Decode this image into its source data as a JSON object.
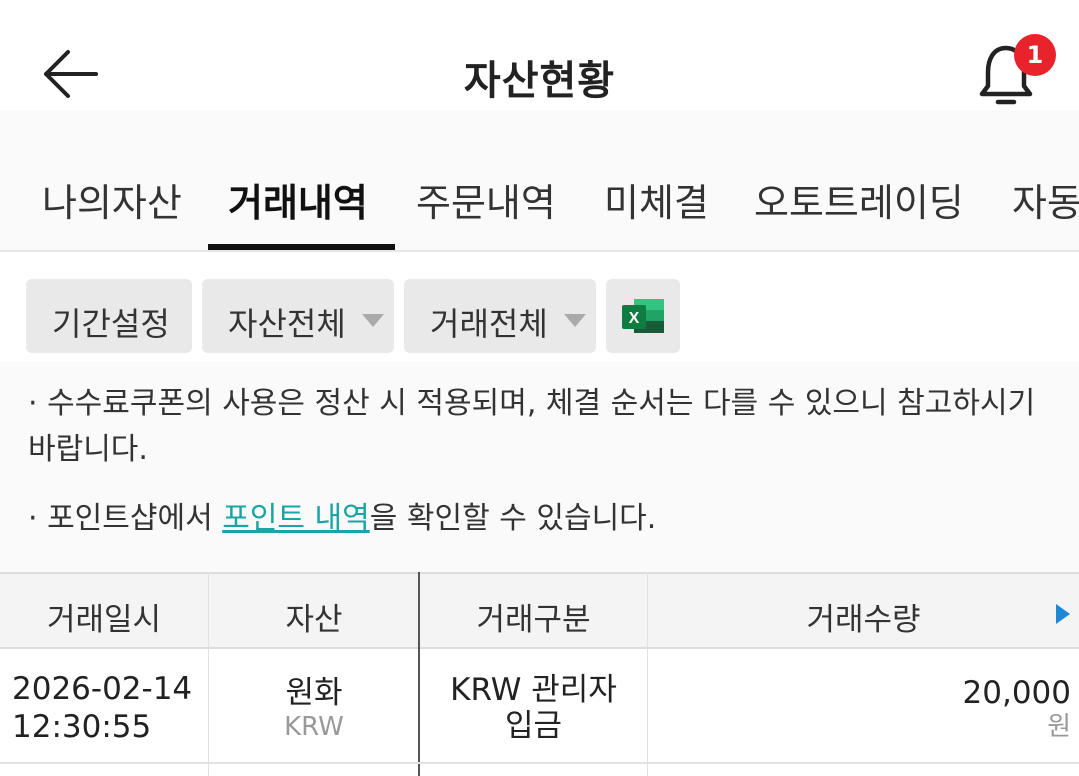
{
  "header": {
    "title": "자산현황",
    "notification_count": "1"
  },
  "tabs": [
    {
      "label": "나의자산",
      "active": false
    },
    {
      "label": "거래내역",
      "active": true
    },
    {
      "label": "주문내역",
      "active": false
    },
    {
      "label": "미체결",
      "active": false
    },
    {
      "label": "오토트레이딩",
      "active": false
    },
    {
      "label": "자동",
      "active": false
    }
  ],
  "filters": {
    "period": "기간설정",
    "asset": "자산전체",
    "trade": "거래전체"
  },
  "notices": {
    "line1": "· 수수료쿠폰의 사용은 정산 시 적용되며, 체결 순서는 다를 수 있으니 참고하시기",
    "line1b": "바랍니다.",
    "line2_pre": "· 포인트샵에서 ",
    "line2_link": "포인트 내역",
    "line2_post": "을 확인할 수 있습니다."
  },
  "table": {
    "columns": [
      "거래일시",
      "자산",
      "거래구분",
      "거래수량"
    ],
    "rows": [
      {
        "date": "2026-02-14",
        "time": "12:30:55",
        "asset": "원화",
        "asset_code": "KRW",
        "type_line1": "KRW 관리자",
        "type_line2": "입금",
        "amount": "20,000",
        "unit": "원"
      }
    ]
  },
  "colors": {
    "link": "#1aa5a5",
    "badge": "#e8232b",
    "scroll_arrow": "#1e88d8"
  }
}
